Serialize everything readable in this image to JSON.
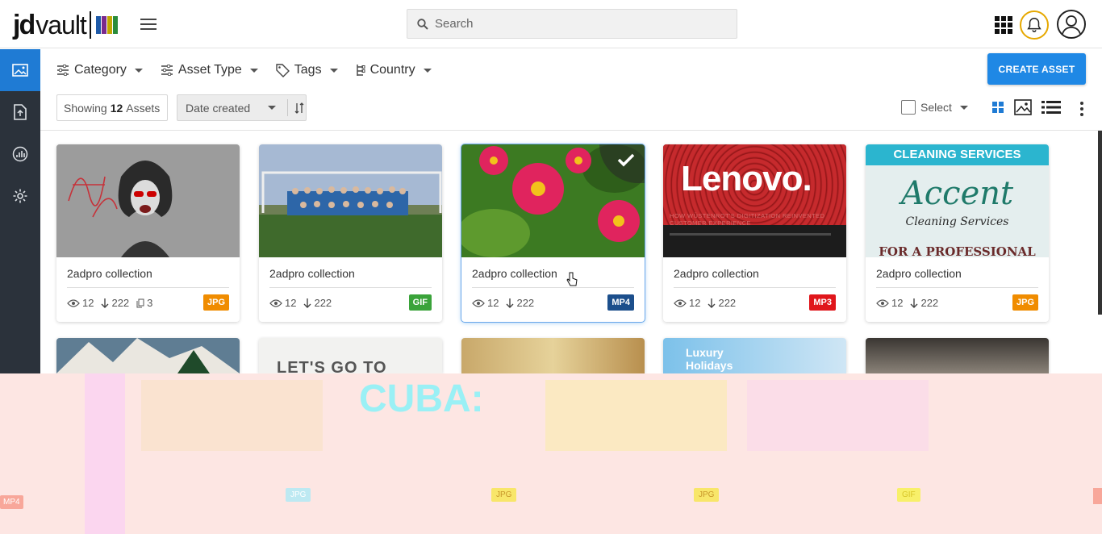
{
  "header": {
    "logo_brand": "jd",
    "logo_word": "vault",
    "logo_colors": [
      "#1e5aa8",
      "#7b2a8c",
      "#c0a600",
      "#2a8c3a"
    ],
    "search_placeholder": "Search"
  },
  "sidebar": {
    "items": [
      {
        "name": "assets",
        "icon": "image-icon",
        "active": true
      },
      {
        "name": "upload",
        "icon": "upload-file-icon",
        "active": false
      },
      {
        "name": "analytics",
        "icon": "chart-icon",
        "active": false
      },
      {
        "name": "settings",
        "icon": "gear-icon",
        "active": false
      }
    ],
    "active_color": "#1f7bd4",
    "background": "#2b323b"
  },
  "filters": {
    "category": "Category",
    "asset_type": "Asset Type",
    "tags": "Tags",
    "country": "Country"
  },
  "toolbar": {
    "create_label": "CREATE ASSET",
    "showing_prefix": "Showing",
    "showing_count": "12",
    "showing_suffix": "Assets",
    "sort_label": "Date created",
    "select_label": "Select"
  },
  "cards": [
    {
      "title": "2adpro collection",
      "views": "12",
      "downloads": "222",
      "copies": "3",
      "badge": "JPG",
      "badge_color": "#f08c00",
      "selected": false
    },
    {
      "title": "2adpro collection",
      "views": "12",
      "downloads": "222",
      "copies": "",
      "badge": "GIF",
      "badge_color": "#3aa33a",
      "selected": false
    },
    {
      "title": "2adpro collection",
      "views": "12",
      "downloads": "222",
      "copies": "",
      "badge": "MP4",
      "badge_color": "#1c4f8c",
      "selected": true
    },
    {
      "title": "2adpro collection",
      "views": "12",
      "downloads": "222",
      "copies": "",
      "badge": "MP3",
      "badge_color": "#e0161b",
      "selected": false
    },
    {
      "title": "2adpro collection",
      "views": "12",
      "downloads": "222",
      "copies": "",
      "badge": "JPG",
      "badge_color": "#f08c00",
      "selected": false
    }
  ],
  "second_row_texts": {
    "card2": "LET'S GO TO",
    "card4_line1": "Luxury",
    "card4_line2": "Holidays"
  },
  "thumb_texts": {
    "lenovo": "Lenovo.",
    "lenovo_sub": "HOW WÜSTENROT'S DIGITIZATION REINVENTED CUSTOMER EXPERIENCE",
    "cleaning_header": "CLEANING SERVICES",
    "cleaning_brand": "Accent",
    "cleaning_sub": "Cleaning Services",
    "cleaning_foot": "FOR A PROFESSIONAL",
    "test_scribble": "test"
  },
  "overlay": {
    "cuba_text": "CUBA:",
    "badges": [
      "MP4",
      "JPG",
      "JPG",
      "JPG",
      "GIF"
    ]
  }
}
